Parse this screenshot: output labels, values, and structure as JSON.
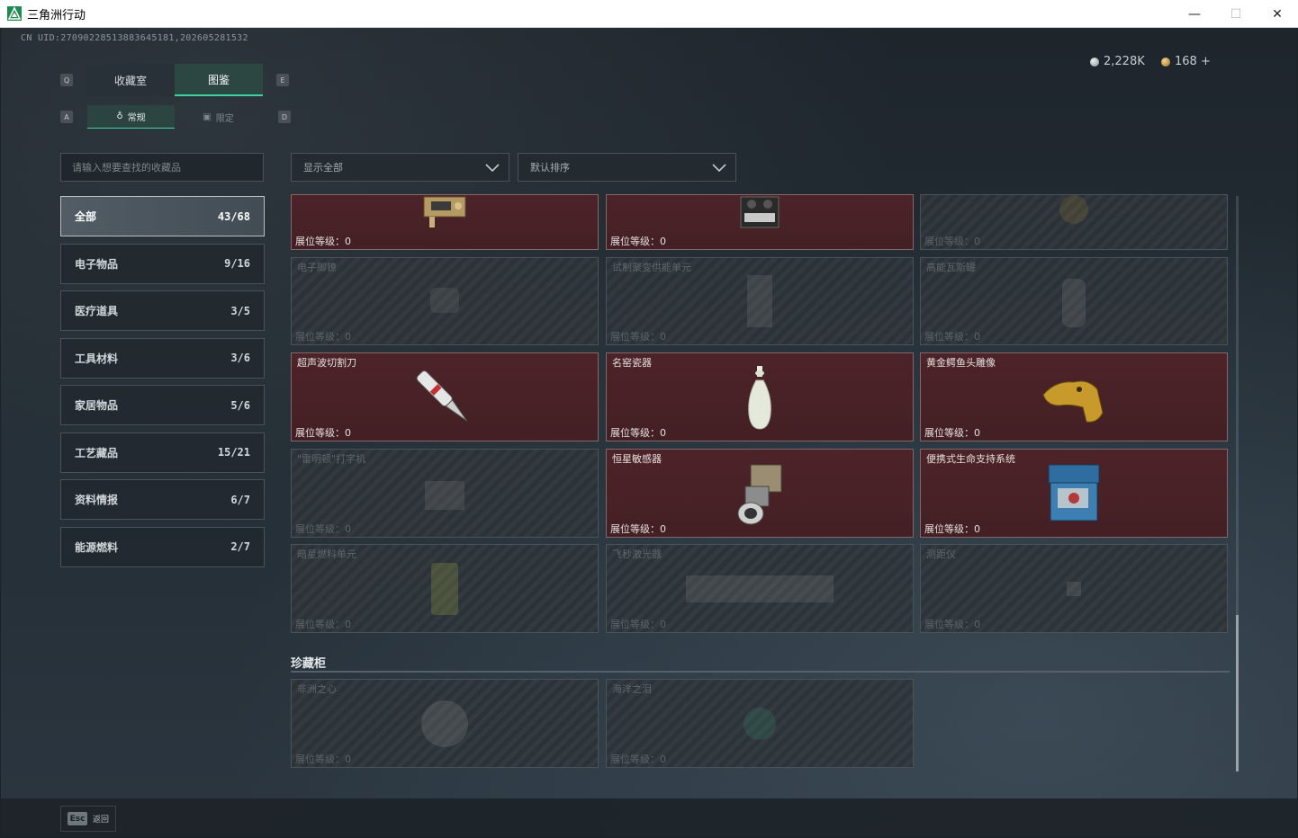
{
  "window": {
    "title": "三角洲行动",
    "minimize": "—",
    "maximize": "☐",
    "close": "✕"
  },
  "header": {
    "uid": "CN UID:2709022851388364518​1,202605281532",
    "currency": [
      {
        "icon": "silver-coin-icon",
        "value": "2,228K"
      },
      {
        "icon": "gold-coin-icon",
        "value": "168 +"
      }
    ]
  },
  "keyhints": {
    "prev_tab": "Q",
    "next_tab": "E",
    "prev_sub": "A",
    "next_sub": "D"
  },
  "tabs": [
    {
      "label": "收藏室",
      "active": false
    },
    {
      "label": "图鉴",
      "active": true
    }
  ],
  "sub_tabs": [
    {
      "label": "常规",
      "icon": "bottle-icon",
      "active": true
    },
    {
      "label": "限定",
      "icon": "image-icon",
      "active": false
    }
  ],
  "search": {
    "placeholder": "请输入想要查找的收藏品"
  },
  "filters": {
    "show": "显示全部",
    "sort": "默认排序"
  },
  "categories": [
    {
      "label": "全部",
      "count": "43/68",
      "active": true
    },
    {
      "label": "电子物品",
      "count": "9/16",
      "active": false
    },
    {
      "label": "医疗道具",
      "count": "3/5",
      "active": false
    },
    {
      "label": "工具材料",
      "count": "3/6",
      "active": false
    },
    {
      "label": "家居物品",
      "count": "5/6",
      "active": false
    },
    {
      "label": "工艺藏品",
      "count": "15/21",
      "active": false
    },
    {
      "label": "资料情报",
      "count": "6/7",
      "active": false
    },
    {
      "label": "能源燃料",
      "count": "2/7",
      "active": false
    }
  ],
  "level_label": "展位等级：0",
  "items": [
    {
      "name": "",
      "owned": true
    },
    {
      "name": "",
      "owned": true
    },
    {
      "name": "",
      "owned": false
    },
    {
      "name": "电子脚镣",
      "owned": false
    },
    {
      "name": "试制聚变供能单元",
      "owned": false
    },
    {
      "name": "高能瓦斯罐",
      "owned": false
    },
    {
      "name": "超声波切割刀",
      "owned": true
    },
    {
      "name": "名窑瓷器",
      "owned": true
    },
    {
      "name": "黄金鳄鱼头雕像",
      "owned": true
    },
    {
      "name": "\"雷明顿\"打字机",
      "owned": false
    },
    {
      "name": "恒星敏感器",
      "owned": true
    },
    {
      "name": "便携式生命支持系统",
      "owned": true
    },
    {
      "name": "暗星燃料单元",
      "owned": false
    },
    {
      "name": "飞秒激光器",
      "owned": false
    },
    {
      "name": "测距仪",
      "owned": false
    }
  ],
  "section": {
    "title": "珍藏柜"
  },
  "treasures": [
    {
      "name": "非洲之心",
      "owned": false
    },
    {
      "name": "海洋之泪",
      "owned": false
    }
  ],
  "footer": {
    "key": "Esc",
    "label": "返回"
  }
}
